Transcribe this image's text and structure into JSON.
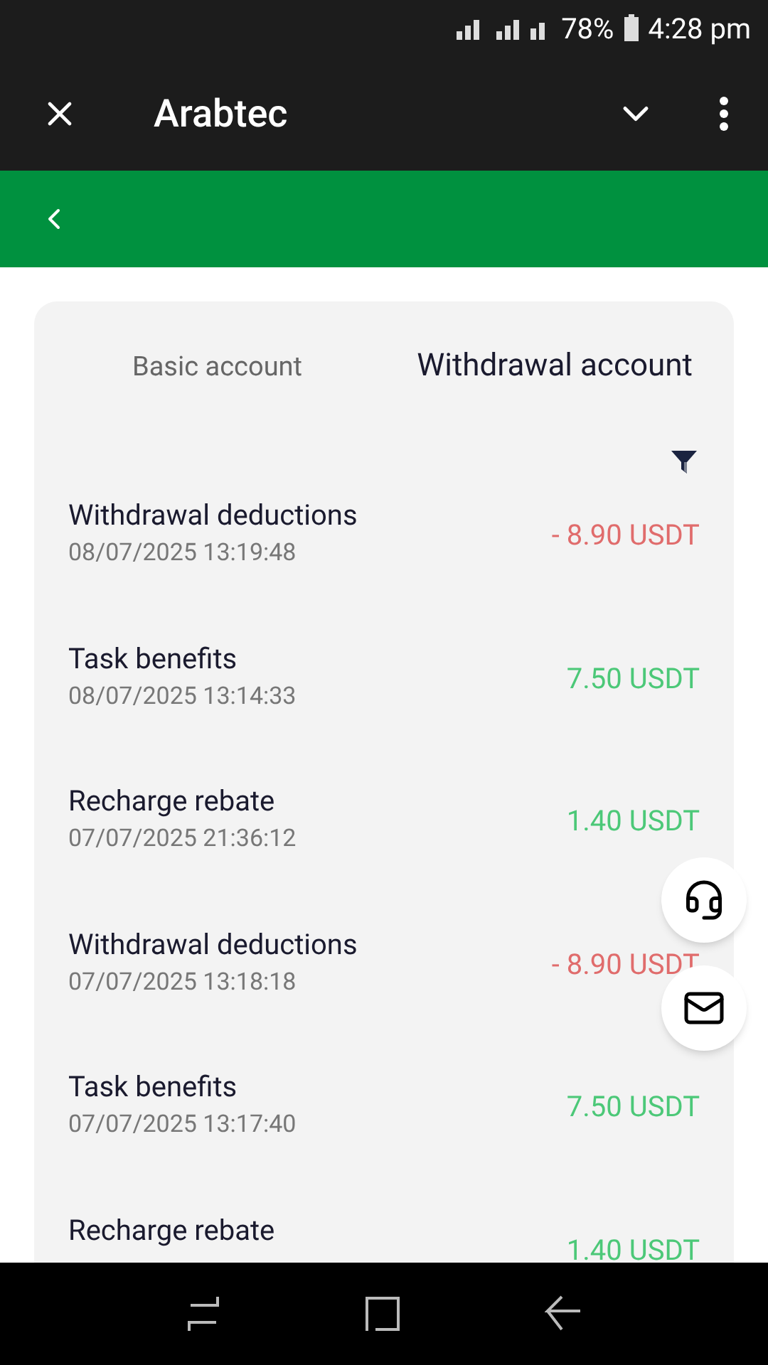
{
  "status_bar": {
    "battery": "78%",
    "time": "4:28 pm"
  },
  "app_bar": {
    "title": "Arabtec"
  },
  "tabs": [
    {
      "label": "Basic account",
      "selected": false
    },
    {
      "label": "Withdrawal account",
      "selected": true
    }
  ],
  "transactions": [
    {
      "title": "Withdrawal deductions",
      "date": "08/07/2025 13:19:48",
      "amount": "- 8.90 USDT",
      "kind": "debit"
    },
    {
      "title": "Task benefits",
      "date": "08/07/2025 13:14:33",
      "amount": "7.50 USDT",
      "kind": "credit"
    },
    {
      "title": "Recharge rebate",
      "date": "07/07/2025 21:36:12",
      "amount": "1.40 USDT",
      "kind": "credit"
    },
    {
      "title": "Withdrawal deductions",
      "date": "07/07/2025 13:18:18",
      "amount": "- 8.90 USDT",
      "kind": "debit"
    },
    {
      "title": "Task benefits",
      "date": "07/07/2025 13:17:40",
      "amount": "7.50 USDT",
      "kind": "credit"
    },
    {
      "title": "Recharge rebate",
      "amount": "1.40 USDT",
      "kind": "credit"
    }
  ]
}
